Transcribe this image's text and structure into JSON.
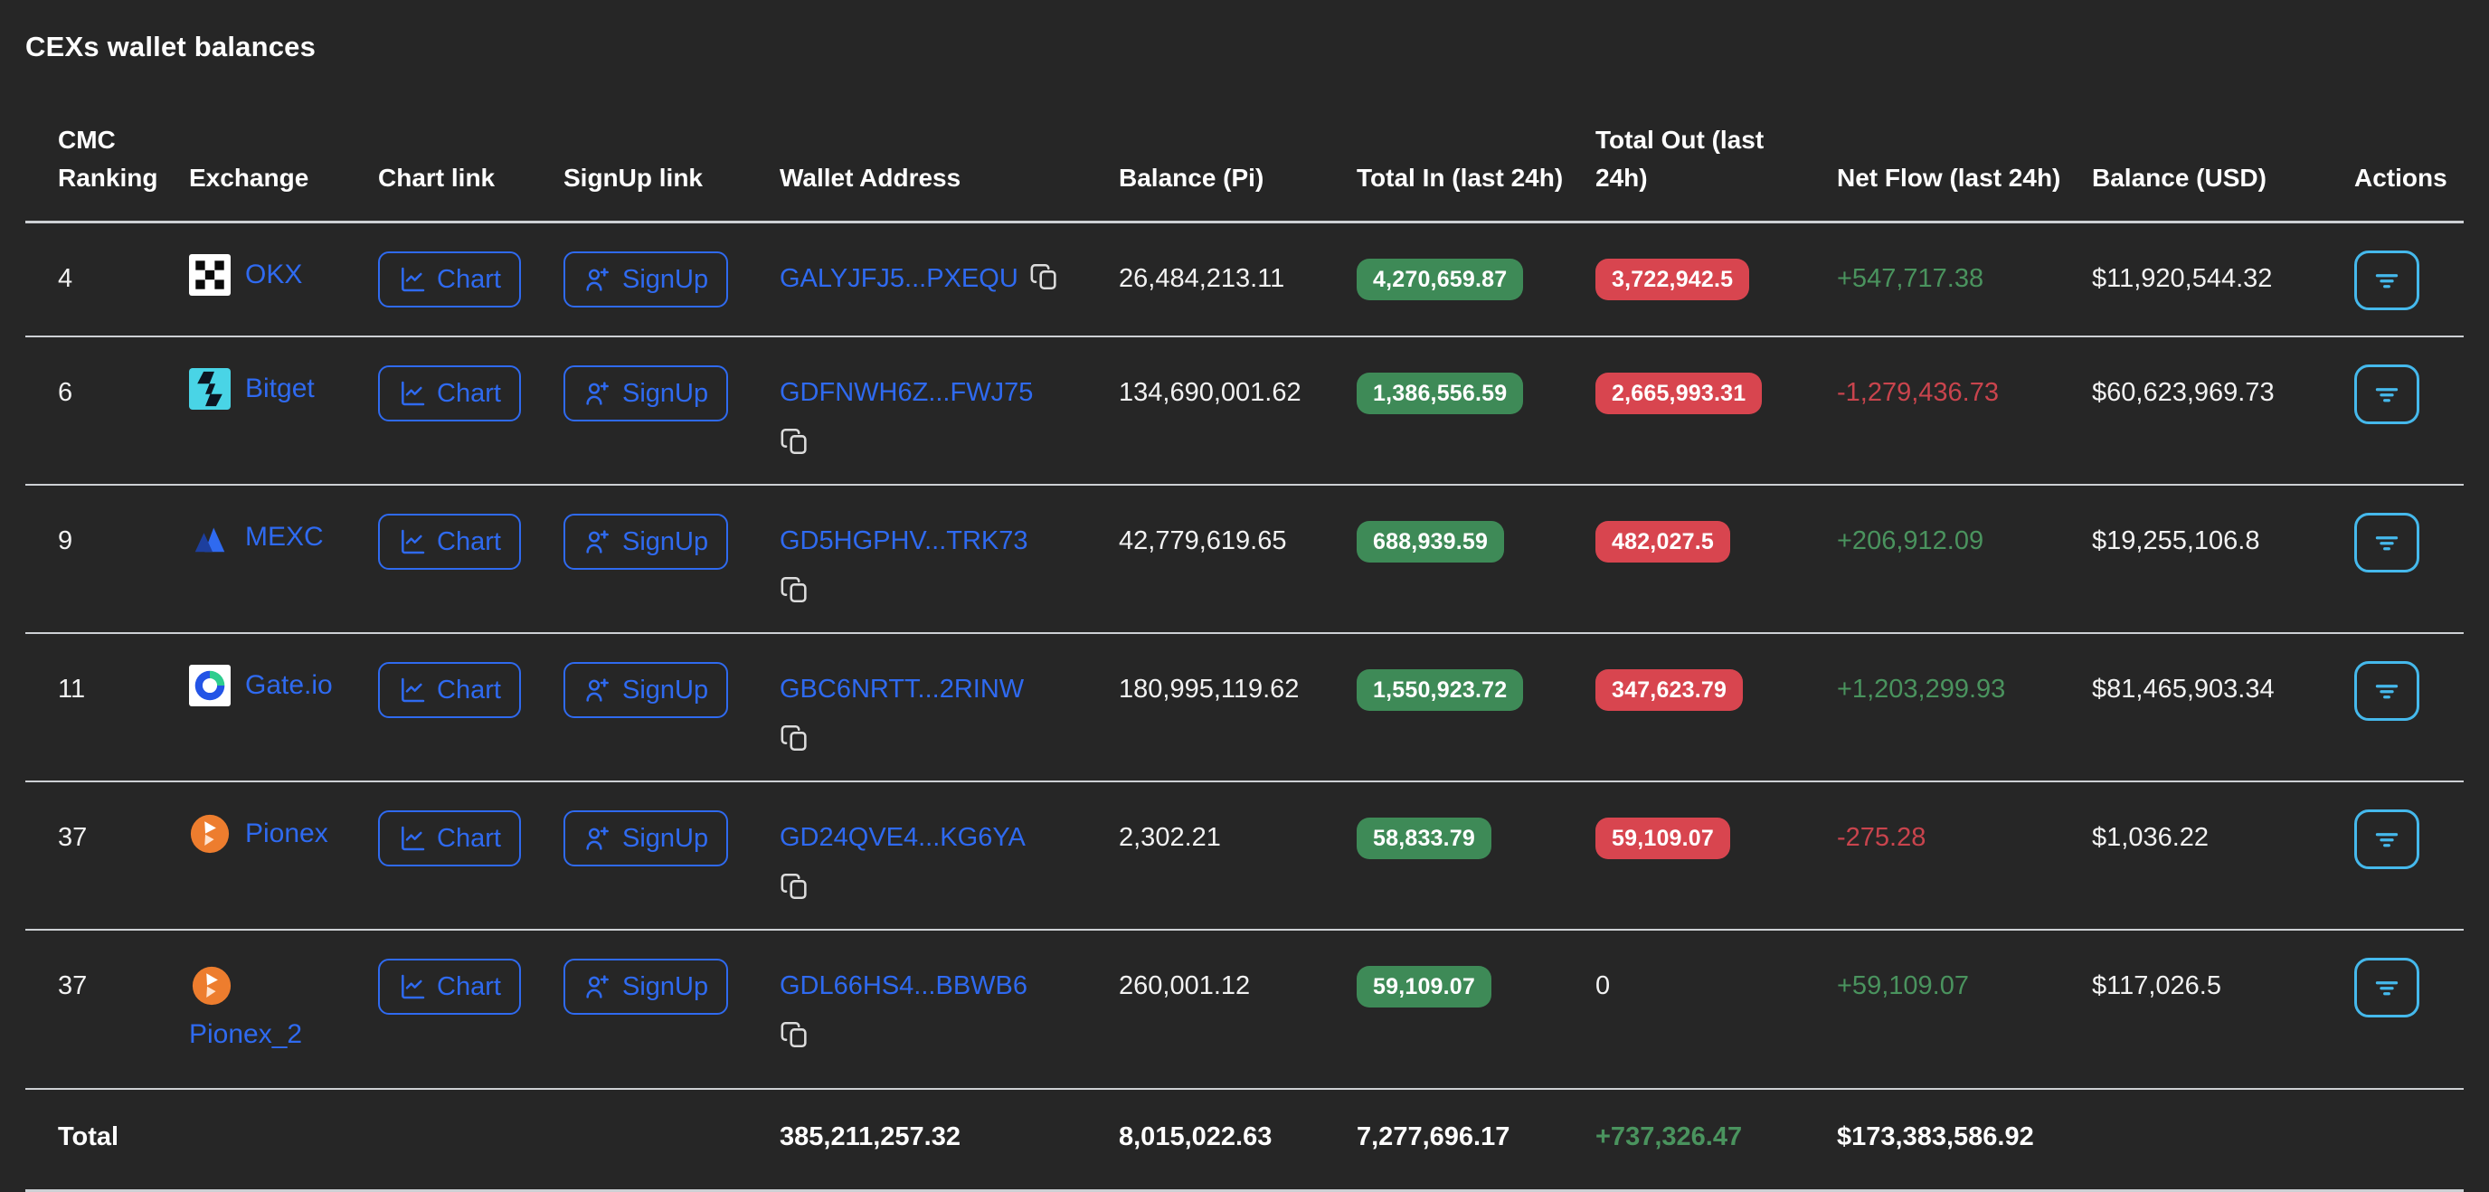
{
  "title": "CEXs wallet balances",
  "colors": {
    "background": "#262626",
    "text": "#f2f2f2",
    "link_blue": "#2f6af0",
    "badge_green": "#3e8a57",
    "badge_red": "#d8454f",
    "positive_green": "#4a935e",
    "negative_red": "#c9444d",
    "action_button_blue": "#45b9ec",
    "divider_gray": "#cdd0d4"
  },
  "table": {
    "columns": [
      "CMC Ranking",
      "Exchange",
      "Chart link",
      "SignUp link",
      "Wallet Address",
      "Balance (Pi)",
      "Total In (last 24h)",
      "Total Out (last 24h)",
      "Net Flow (last 24h)",
      "Balance (USD)",
      "Actions"
    ],
    "labels": {
      "chart": "Chart",
      "signup": "SignUp"
    },
    "rows": [
      {
        "cmc_ranking": "4",
        "exchange": "OKX",
        "logo": "okx",
        "exchange_wrap": false,
        "wallet": "GALYJFJ5...PXEQU",
        "wallet_wrap": false,
        "balance_pi": "26,484,213.11",
        "total_in": "4,270,659.87",
        "total_out": "3,722,942.5",
        "total_out_badge": true,
        "net_flow": "+547,717.38",
        "net_flow_sign": "pos",
        "balance_usd": "$11,920,544.32"
      },
      {
        "cmc_ranking": "6",
        "exchange": "Bitget",
        "logo": "bitget",
        "exchange_wrap": false,
        "wallet": "GDFNWH6Z...FWJ75",
        "wallet_wrap": true,
        "balance_pi": "134,690,001.62",
        "total_in": "1,386,556.59",
        "total_out": "2,665,993.31",
        "total_out_badge": true,
        "net_flow": "-1,279,436.73",
        "net_flow_sign": "neg",
        "balance_usd": "$60,623,969.73"
      },
      {
        "cmc_ranking": "9",
        "exchange": "MEXC",
        "logo": "mexc",
        "exchange_wrap": false,
        "wallet": "GD5HGPHV...TRK73",
        "wallet_wrap": true,
        "balance_pi": "42,779,619.65",
        "total_in": "688,939.59",
        "total_out": "482,027.5",
        "total_out_badge": true,
        "net_flow": "+206,912.09",
        "net_flow_sign": "pos",
        "balance_usd": "$19,255,106.8"
      },
      {
        "cmc_ranking": "11",
        "exchange": "Gate.io",
        "logo": "gateio",
        "exchange_wrap": false,
        "wallet": "GBC6NRTT...2RINW",
        "wallet_wrap": true,
        "balance_pi": "180,995,119.62",
        "total_in": "1,550,923.72",
        "total_out": "347,623.79",
        "total_out_badge": true,
        "net_flow": "+1,203,299.93",
        "net_flow_sign": "pos",
        "balance_usd": "$81,465,903.34"
      },
      {
        "cmc_ranking": "37",
        "exchange": "Pionex",
        "logo": "pionex",
        "exchange_wrap": false,
        "wallet": "GD24QVE4...KG6YA",
        "wallet_wrap": true,
        "balance_pi": "2,302.21",
        "total_in": "58,833.79",
        "total_out": "59,109.07",
        "total_out_badge": true,
        "net_flow": "-275.28",
        "net_flow_sign": "neg",
        "balance_usd": "$1,036.22"
      },
      {
        "cmc_ranking": "37",
        "exchange": "Pionex_2",
        "logo": "pionex",
        "exchange_wrap": true,
        "wallet": "GDL66HS4...BBWB6",
        "wallet_wrap": true,
        "balance_pi": "260,001.12",
        "total_in": "59,109.07",
        "total_out": "0",
        "total_out_badge": false,
        "net_flow": "+59,109.07",
        "net_flow_sign": "pos",
        "balance_usd": "$117,026.5"
      }
    ],
    "total": {
      "label": "Total",
      "balance_pi": "385,211,257.32",
      "total_in": "8,015,022.63",
      "total_out": "7,277,696.17",
      "net_flow": "+737,326.47",
      "net_flow_sign": "pos",
      "balance_usd": "$173,383,586.92"
    }
  }
}
